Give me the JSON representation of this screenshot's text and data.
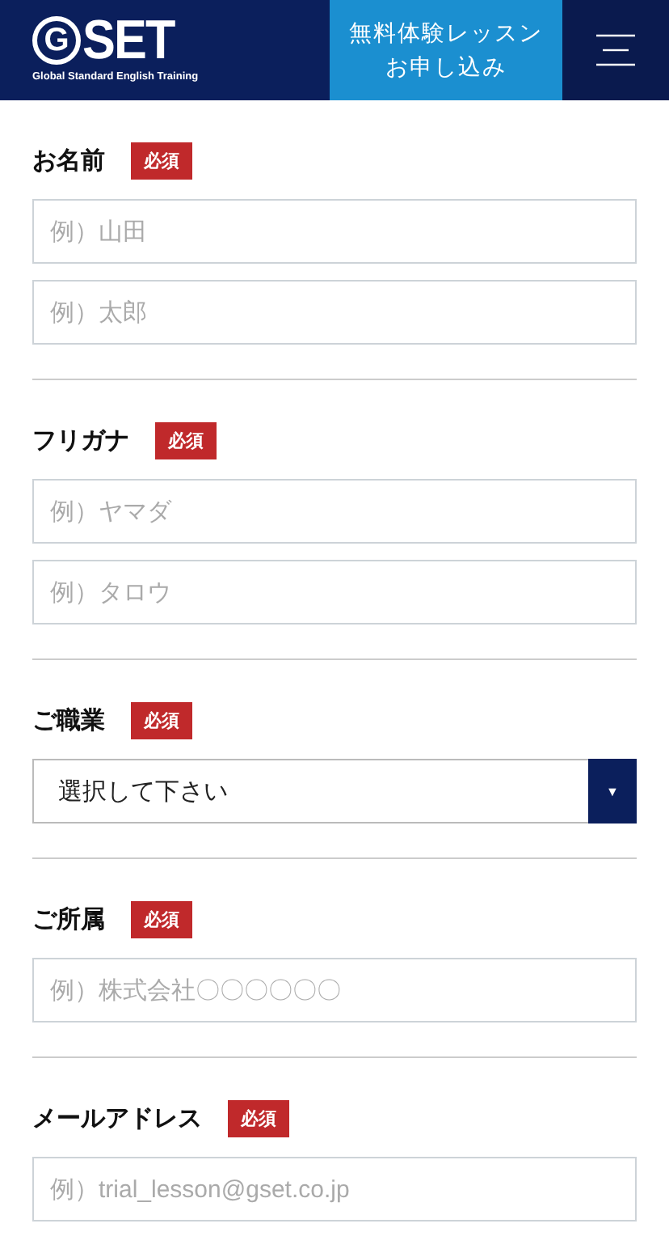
{
  "header": {
    "logo": {
      "mark": "G",
      "name": "SET",
      "tagline": "Global Standard English Training"
    },
    "cta": {
      "line1": "無料体験レッスン",
      "line2": "お申し込み"
    }
  },
  "sections": [
    {
      "label": "お名前",
      "required": true,
      "badge": "必須",
      "kind": "text",
      "fields": [
        {
          "placeholder": "例）山田"
        },
        {
          "placeholder": "例）太郎"
        }
      ]
    },
    {
      "label": "フリガナ",
      "required": true,
      "badge": "必須",
      "kind": "text",
      "fields": [
        {
          "placeholder": "例）ヤマダ"
        },
        {
          "placeholder": "例）タロウ"
        }
      ]
    },
    {
      "label": "ご職業",
      "required": true,
      "badge": "必須",
      "kind": "select",
      "value": "選択して下さい",
      "arrow": "▼"
    },
    {
      "label": "ご所属",
      "required": true,
      "badge": "必須",
      "kind": "text",
      "fields": [
        {
          "placeholder": "例）株式会社〇〇〇〇〇〇"
        }
      ]
    },
    {
      "label": "メールアドレス",
      "required": true,
      "badge": "必須",
      "kind": "text",
      "fields": [
        {
          "placeholder": "例）trial_lesson@gset.co.jp"
        }
      ]
    }
  ]
}
